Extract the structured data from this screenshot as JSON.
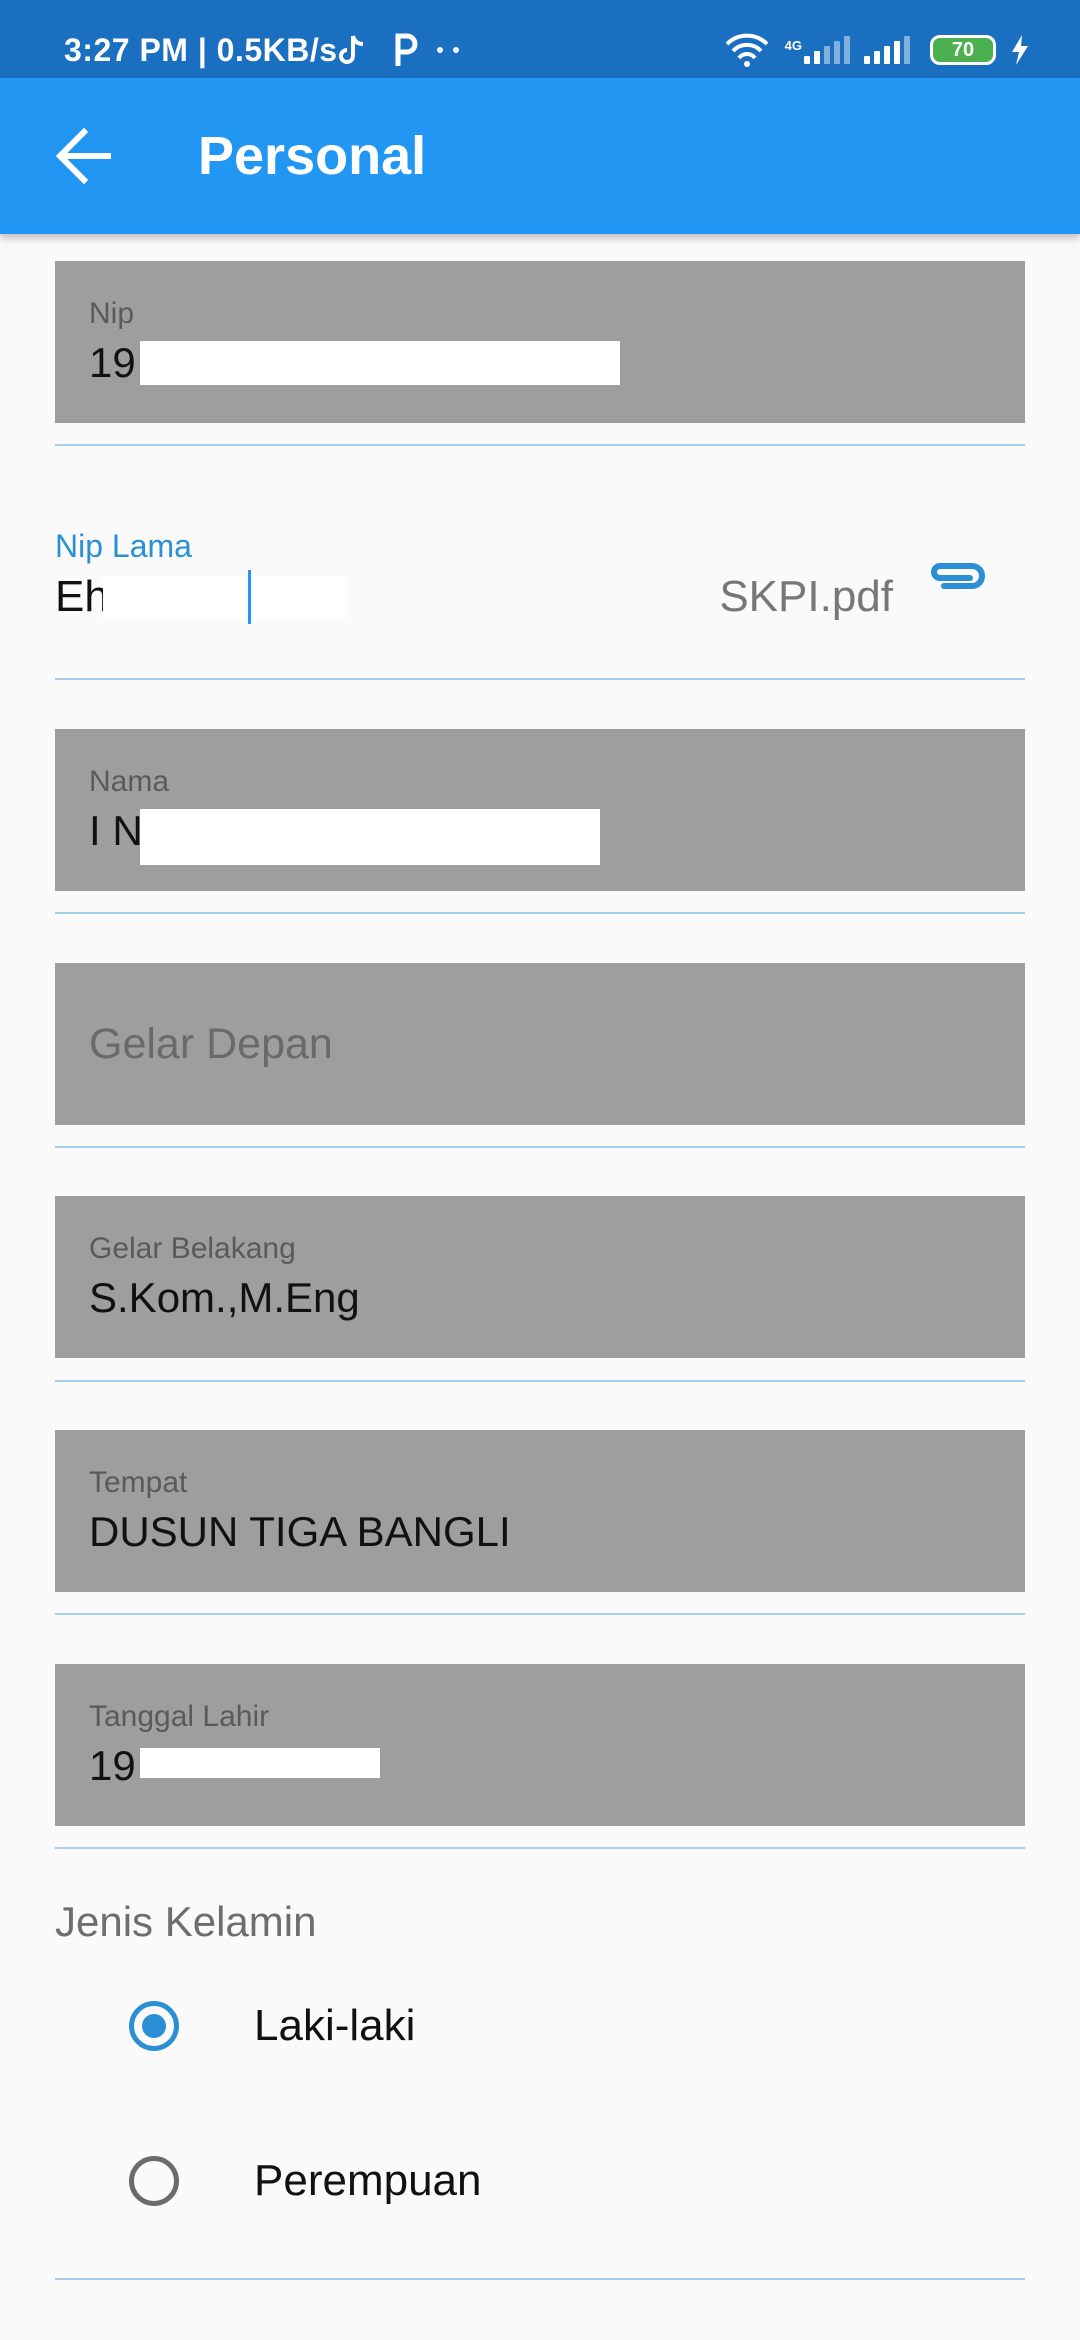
{
  "status_bar": {
    "time": "3:27 PM | 0.5KB/s",
    "network_type": "4G",
    "battery_level": "70"
  },
  "app_bar": {
    "back_icon": "arrow-back-icon",
    "title": "Personal"
  },
  "form": {
    "nip": {
      "label": "Nip",
      "value": "19"
    },
    "nip_lama": {
      "label": "Nip Lama",
      "value": "Eh",
      "attachment": "SKPI.pdf",
      "attachment_icon": "paperclip-icon"
    },
    "nama": {
      "label": "Nama",
      "value": "I N"
    },
    "gelar_depan": {
      "placeholder": "Gelar Depan"
    },
    "gelar_belakang": {
      "label": "Gelar Belakang",
      "value": "S.Kom.,M.Eng"
    },
    "tempat": {
      "label": "Tempat",
      "value": "DUSUN TIGA BANGLI"
    },
    "tanggal_lahir": {
      "label": "Tanggal Lahir",
      "value": "19"
    },
    "jenis_kelamin": {
      "label": "Jenis Kelamin",
      "options": [
        {
          "label": "Laki-laki",
          "selected": true
        },
        {
          "label": "Perempuan",
          "selected": false
        }
      ]
    }
  },
  "colors": {
    "status_bar": "#1b6fc0",
    "app_bar": "#2196f3",
    "accent": "#2a8fd4",
    "disabled_field": "#9e9e9e"
  }
}
